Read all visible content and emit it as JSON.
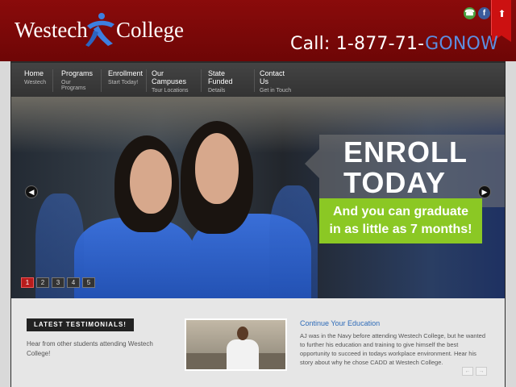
{
  "header": {
    "logo_word1": "Westech",
    "logo_word2": "College",
    "call_prefix": "Call: 1-877-71-",
    "call_accent": "GONOW",
    "brand_color": "#7b0808",
    "accent_color": "#5c8ee0"
  },
  "social": {
    "phone_icon": "phone-icon",
    "facebook_icon": "facebook-icon",
    "facebook_glyph": "f",
    "phone_glyph": "☎"
  },
  "nav": {
    "items": [
      {
        "title": "Home",
        "sub": "Westech"
      },
      {
        "title": "Programs",
        "sub": "Our Programs"
      },
      {
        "title": "Enrollment",
        "sub": "Start Today!"
      },
      {
        "title": "Our Campuses",
        "sub": "Tour Locations"
      },
      {
        "title": "State Funded",
        "sub": "Details"
      },
      {
        "title": "Contact Us",
        "sub": "Get in Touch"
      }
    ]
  },
  "hero": {
    "enroll_line1": "ENROLL",
    "enroll_line2": "TODAY",
    "graduate_line1": "And you can graduate",
    "graduate_line2": "in as little as 7 months!",
    "prev_glyph": "◀",
    "next_glyph": "▶",
    "slides": [
      "1",
      "2",
      "3",
      "4",
      "5"
    ],
    "active_slide": 1,
    "green_color": "#8bc824"
  },
  "testimonials": {
    "badge": "LATEST TESTIMONIALS!",
    "intro": "Hear from other students attending Westech College!"
  },
  "continue": {
    "title": "Continue Your Education",
    "body": "AJ was in the Navy before attending Westech College, but he wanted to further his education and training to give himself the best opportunity to succeed in todays workplace environment. Hear his story about why he chose CADD at Westech College.",
    "prev_glyph": "←",
    "next_glyph": "→"
  }
}
